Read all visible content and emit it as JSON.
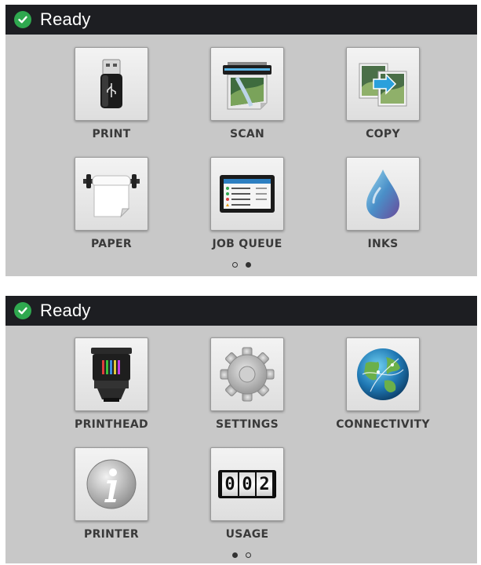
{
  "screens": [
    {
      "status": {
        "text": "Ready",
        "icon": "check-circle-icon",
        "color": "#2fa84f"
      },
      "tiles": [
        {
          "label": "PRINT",
          "icon": "usb-drive-icon"
        },
        {
          "label": "SCAN",
          "icon": "scan-icon"
        },
        {
          "label": "COPY",
          "icon": "copy-icon"
        },
        {
          "label": "PAPER",
          "icon": "paper-roll-icon"
        },
        {
          "label": "JOB QUEUE",
          "icon": "job-queue-icon"
        },
        {
          "label": "INKS",
          "icon": "ink-drop-icon"
        }
      ],
      "page_indicator": {
        "current": 1,
        "total": 2
      }
    },
    {
      "status": {
        "text": "Ready",
        "icon": "check-circle-icon",
        "color": "#2fa84f"
      },
      "tiles": [
        {
          "label": "PRINTHEAD",
          "icon": "printhead-icon"
        },
        {
          "label": "SETTINGS",
          "icon": "gear-icon"
        },
        {
          "label": "CONNECTIVITY",
          "icon": "globe-icon"
        },
        {
          "label": "PRINTER",
          "icon": "info-icon"
        },
        {
          "label": "USAGE",
          "icon": "counter-icon"
        }
      ],
      "usage_counter": {
        "digits": [
          "0",
          "0",
          "2"
        ]
      },
      "page_indicator": {
        "current": 2,
        "total": 2
      }
    }
  ]
}
